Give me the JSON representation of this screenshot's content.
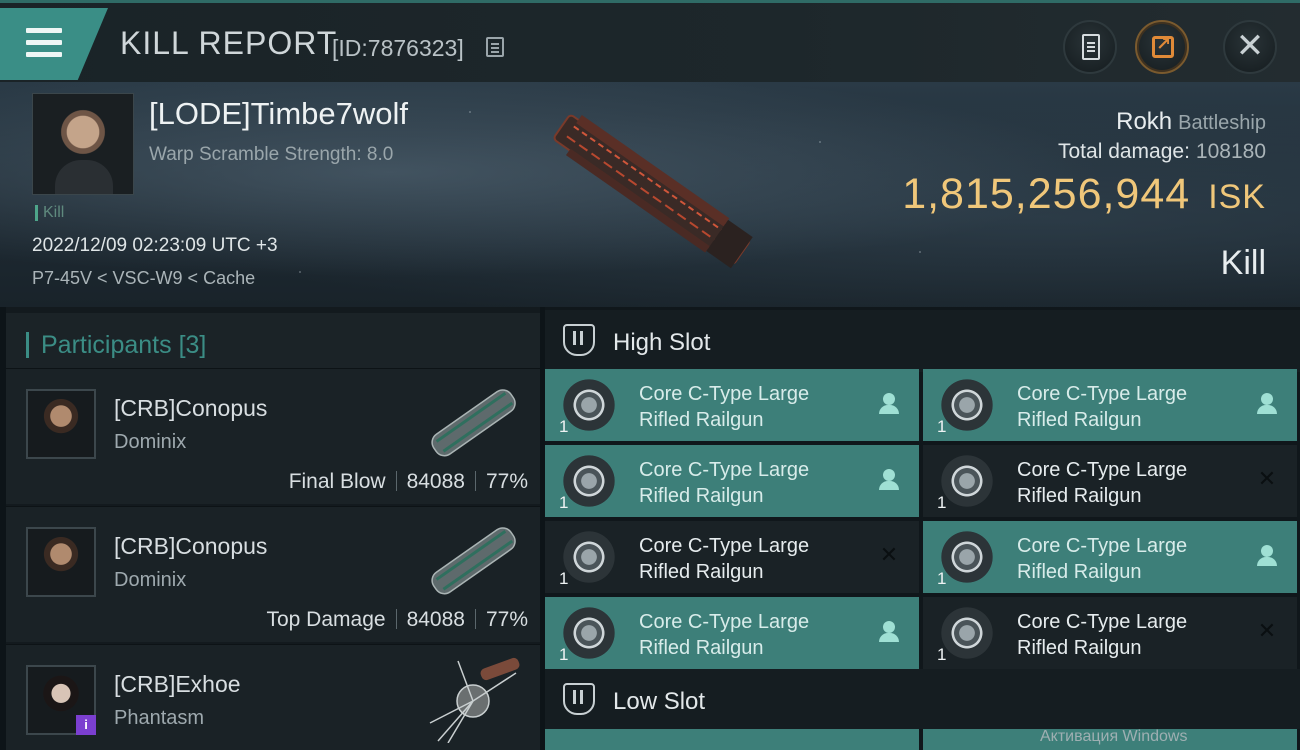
{
  "header": {
    "title": "KILL REPORT",
    "report_id": "[ID:7876323]",
    "icons": [
      "menu-icon",
      "copy-icon",
      "clipboard-icon",
      "share-icon",
      "close-icon"
    ]
  },
  "victim": {
    "name": "[LODE]Timbe7wolf",
    "warp_scramble": "Warp Scramble Strength: 8.0",
    "kill_tag": "Kill",
    "timestamp": "2022/12/09 02:23:09 UTC +3",
    "location": "P7-45V < VSC-W9 < Cache",
    "ship_name": "Rokh",
    "ship_class": "Battleship",
    "total_damage_label": "Total damage:",
    "total_damage_value": "108180",
    "isk_value": "1,815,256,944",
    "isk_unit": "ISK",
    "status": "Kill"
  },
  "participants": {
    "title": "Participants",
    "count": "[3]",
    "items": [
      {
        "name": "[CRB]Conopus",
        "ship": "Dominix",
        "role": "Final Blow",
        "damage": "84088",
        "percent": "77%"
      },
      {
        "name": "[CRB]Conopus",
        "ship": "Dominix",
        "role": "Top Damage",
        "damage": "84088",
        "percent": "77%"
      },
      {
        "name": "[CRB]Exhoe",
        "ship": "Phantasm",
        "badge": "i"
      }
    ]
  },
  "fittings": {
    "high_slot_title": "High Slot",
    "low_slot_title": "Low Slot",
    "high_slot": [
      {
        "name": "Core C-Type Large\nRifled Railgun",
        "qty": "1",
        "status": "fitted"
      },
      {
        "name": "Core C-Type Large\nRifled Railgun",
        "qty": "1",
        "status": "fitted"
      },
      {
        "name": "Core C-Type Large\nRifled Railgun",
        "qty": "1",
        "status": "fitted"
      },
      {
        "name": "Core C-Type Large\nRifled Railgun",
        "qty": "1",
        "status": "destroyed"
      },
      {
        "name": "Core C-Type Large\nRifled Railgun",
        "qty": "1",
        "status": "destroyed"
      },
      {
        "name": "Core C-Type Large\nRifled Railgun",
        "qty": "1",
        "status": "fitted"
      },
      {
        "name": "Core C-Type Large\nRifled Railgun",
        "qty": "1",
        "status": "fitted"
      },
      {
        "name": "Core C-Type Large\nRifled Railgun",
        "qty": "1",
        "status": "destroyed"
      }
    ]
  },
  "os_watermark": "Активация Windows",
  "colors": {
    "accent": "#3b8d85",
    "isk": "#f0c77a",
    "fitted": "#3d7f79",
    "empty": "#1a2226"
  }
}
